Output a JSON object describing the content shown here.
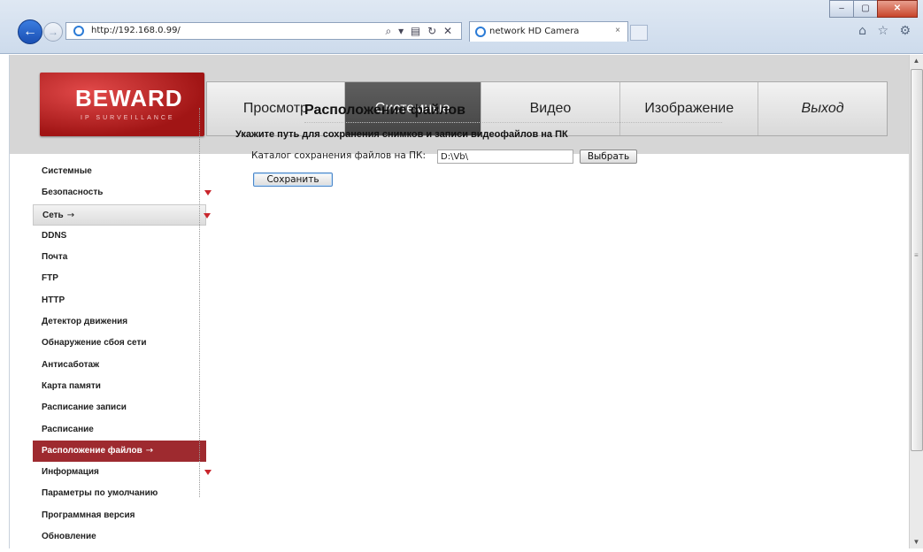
{
  "browser": {
    "address": "http://192.168.0.99/",
    "address_tools": "⌕ ▾ ▤ ↻ ✕",
    "tab_title": "network HD Camera",
    "tab_close": "×",
    "window_buttons": {
      "minimize": "–",
      "maximize": "▢",
      "close": "✕"
    },
    "fav_icons": "⌂ ☆ ⚙"
  },
  "logo": {
    "text": "BEWARD",
    "sub": "IP SURVEILLANCE"
  },
  "top_menu": [
    {
      "label": "Просмотр",
      "active": false
    },
    {
      "label": "Системные",
      "active": true
    },
    {
      "label": "Видео",
      "active": false
    },
    {
      "label": "Изображение",
      "active": false
    },
    {
      "label": "Выход",
      "active": false
    }
  ],
  "sidebar": {
    "items": [
      {
        "label": "Системные"
      },
      {
        "label": "Безопасность",
        "expandable": true
      },
      {
        "label": "Сеть",
        "expandable": true,
        "open": true,
        "arrow": "→"
      },
      {
        "label": "DDNS"
      },
      {
        "label": "Почта"
      },
      {
        "label": "FTP"
      },
      {
        "label": "HTTP"
      },
      {
        "label": "Детектор движения"
      },
      {
        "label": "Обнаружение сбоя сети"
      },
      {
        "label": "Антисаботаж"
      },
      {
        "label": "Карта памяти"
      },
      {
        "label": "Расписание записи"
      },
      {
        "label": "Расписание"
      },
      {
        "label": "Расположение файлов",
        "active": true,
        "arrow": "→"
      },
      {
        "label": "Информация",
        "expandable": true
      },
      {
        "label": "Параметры по умолчанию"
      },
      {
        "label": "Программная версия"
      },
      {
        "label": "Обновление"
      }
    ]
  },
  "main": {
    "title": "Расположение файлов",
    "subtitle": "Укажите путь для сохранения снимков и записи видеофайлов на ПК",
    "path_label": "Каталог сохранения файлов на ПК:",
    "path_value": "D:\\Vb\\",
    "browse_button": "Выбрать",
    "save_button": "Сохранить"
  },
  "colors": {
    "menu_active": "#4e4e4e",
    "sidebar_active": "#9e2a2f",
    "triangle": "#c9262c",
    "logo": "#b81d1d"
  }
}
